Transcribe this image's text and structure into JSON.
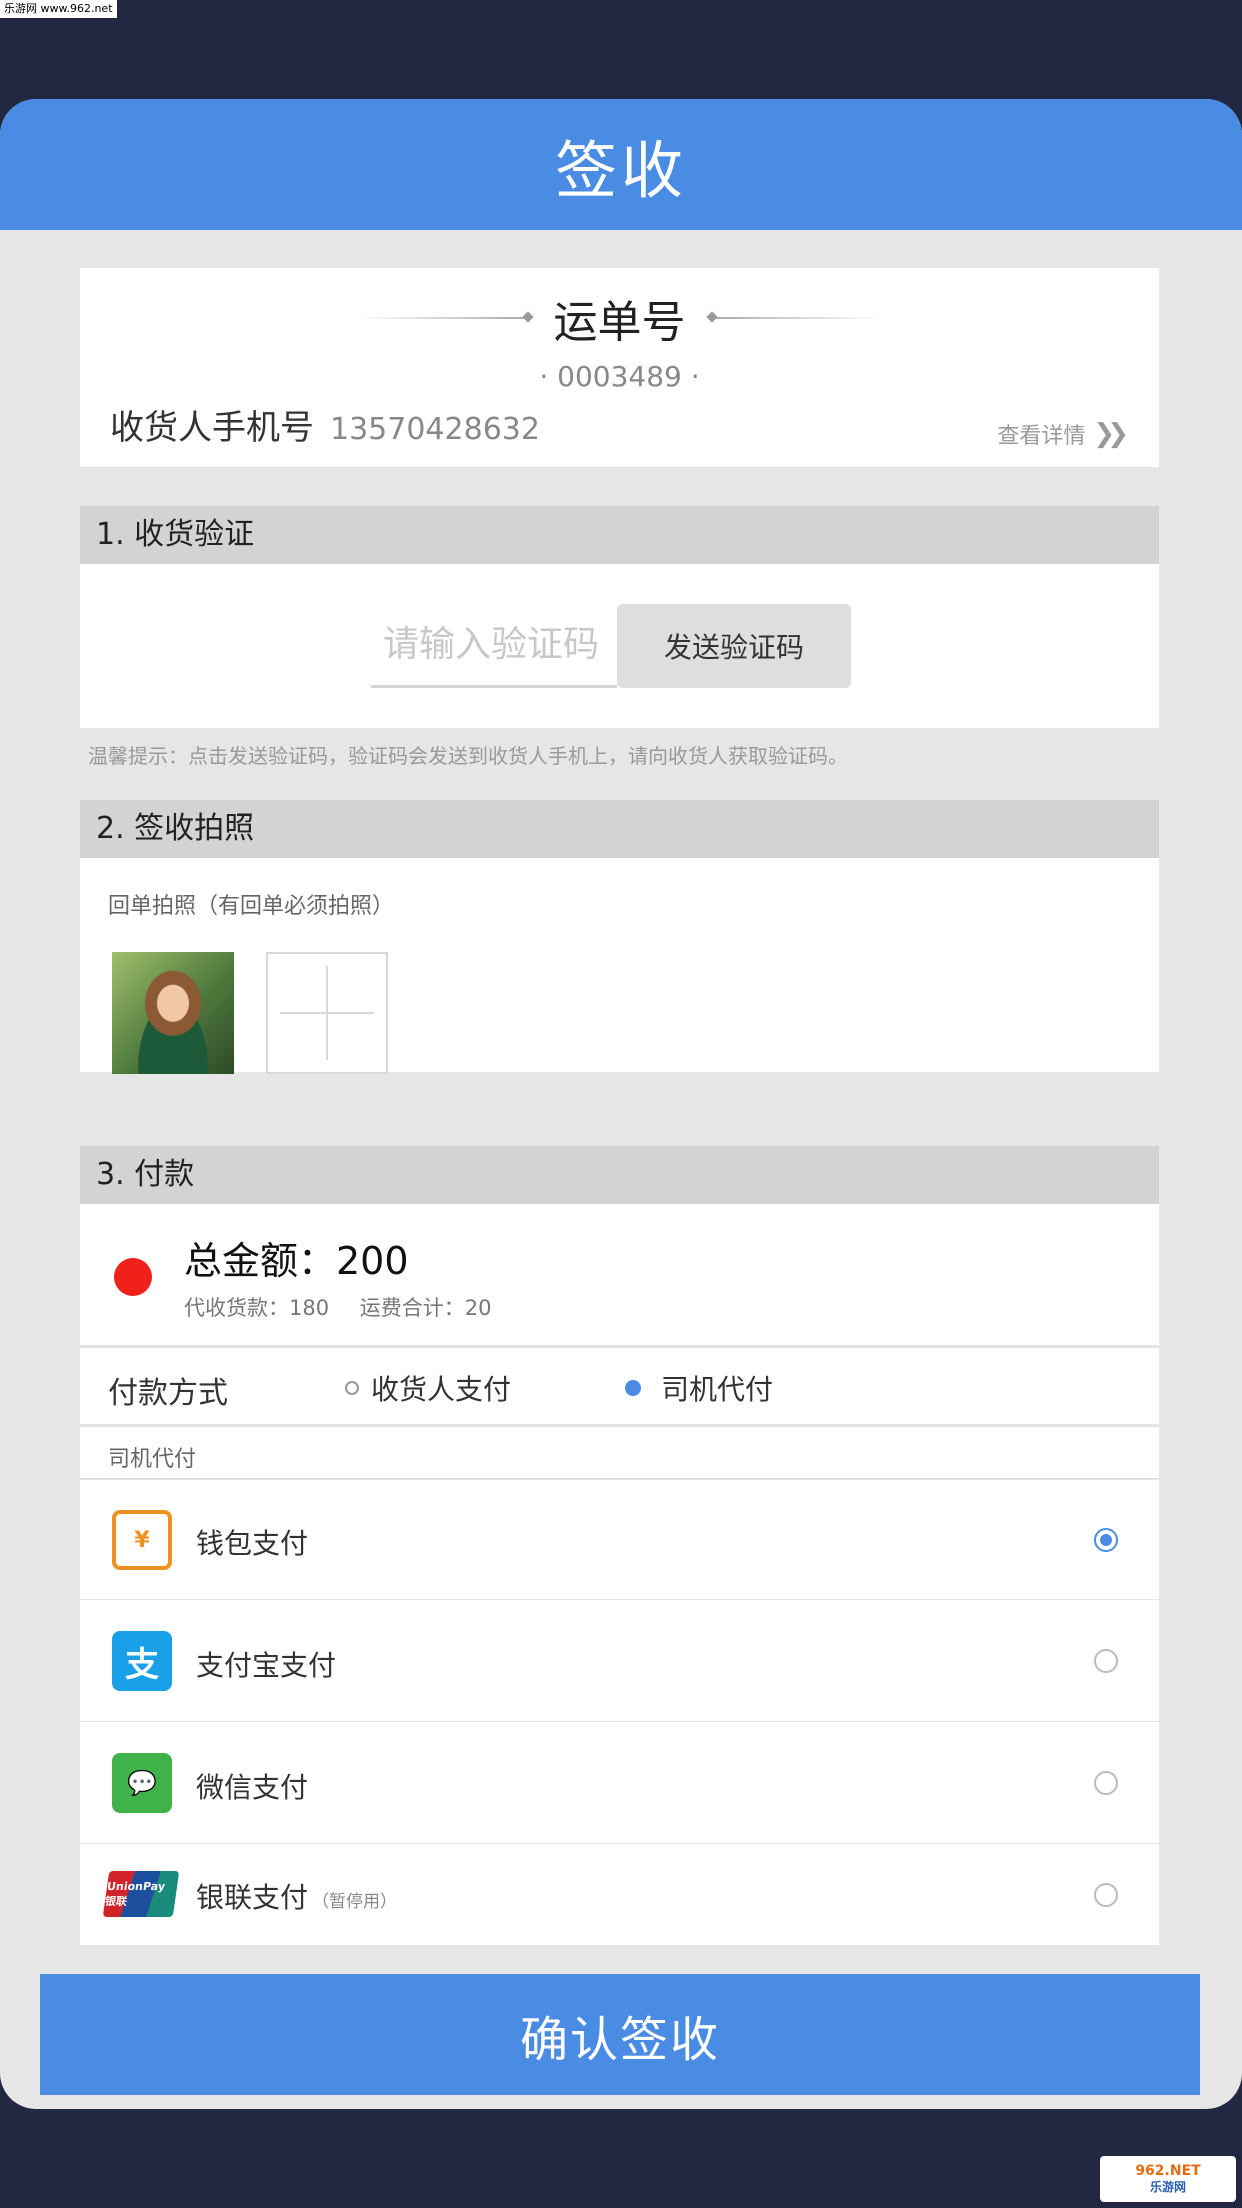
{
  "watermark": {
    "top": "乐游网 www.962.net",
    "bottom_main": "962.NET",
    "bottom_sub": "乐游网"
  },
  "header": {
    "title": "签收"
  },
  "waybill": {
    "title": "运单号",
    "number": "· 0003489 ·",
    "phone_label": "收货人手机号",
    "phone_value": "13570428632",
    "details_link": "查看详情"
  },
  "section1": {
    "title": "1. 收货验证",
    "input_placeholder": "请输入验证码",
    "input_value": "",
    "send_button": "发送验证码",
    "tip": "温馨提示：点击发送验证码，验证码会发送到收货人手机上，请向收货人获取验证码。"
  },
  "section2": {
    "title": "2. 签收拍照",
    "photos_label": "回单拍照（有回单必须拍照）"
  },
  "section3": {
    "title": "3. 付款",
    "total": "总金额：200",
    "cod": "代收货款：180",
    "freight": "运费合计：20",
    "paymode_label": "付款方式",
    "options": [
      "收货人支付",
      "司机代付"
    ],
    "selected_option": "司机代付",
    "agent_label": "司机代付",
    "methods": [
      {
        "name": "钱包支付",
        "note": "",
        "icon": "wallet-icon",
        "icon_glyph": "¥",
        "selected": true
      },
      {
        "name": "支付宝支付",
        "note": "",
        "icon": "alipay-icon",
        "icon_glyph": "支",
        "selected": false
      },
      {
        "name": "微信支付",
        "note": "",
        "icon": "wechat-icon",
        "icon_glyph": "💬",
        "selected": false
      },
      {
        "name": "银联支付",
        "note": "（暂停用）",
        "icon": "unionpay-icon",
        "icon_glyph": "UnionPay 银联",
        "selected": false
      }
    ]
  },
  "confirm_button": "确认签收",
  "colors": {
    "accent": "#4a8be4",
    "background": "#222842",
    "panel": "#e6e6e6",
    "red_dot": "#f0201a"
  }
}
